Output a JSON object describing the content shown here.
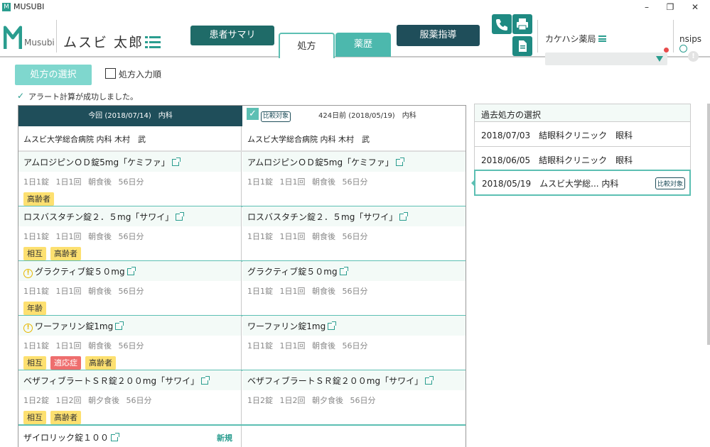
{
  "window": {
    "title": "MUSUBI",
    "app_icon": "M"
  },
  "header": {
    "brand": "Musubi",
    "patient_name": "ムスビ 太郎",
    "buttons": {
      "summary": "患者サマリ",
      "guidance": "服薬指導"
    },
    "tabs": {
      "prescription": "処方",
      "history": "薬歴"
    },
    "pharmacy": "カケハシ薬局",
    "nsips": "nsips"
  },
  "toolbar": {
    "select_prescription": "処方の選択",
    "input_order_label": "処方入力順",
    "alert_message": "アラート計算が成功しました。"
  },
  "grid": {
    "current_header": "今回 (2018/07/14)　内科",
    "compare_badge": "比較対象",
    "compare_header": "424日前 (2018/05/19)　内科",
    "hospital_left": "ムスビ大学総合病院 内科 木村　武",
    "hospital_right": "ムスビ大学総合病院 内科 木村　武",
    "rows": [
      {
        "left": {
          "name": "アムロジピンＯＤ錠5mg「ケミファ」",
          "dose": "1日1錠 1日1回 朝食後 56日分",
          "tags": [
            "高齢者"
          ]
        },
        "right": {
          "name": "アムロジピンＯＤ錠5mg「ケミファ」",
          "dose": "1日1錠 1日1回 朝食後 56日分"
        }
      },
      {
        "left": {
          "name": "ロスバスタチン錠２．５mg「サワイ」",
          "dose": "1日1錠 1日1回 朝食後 56日分",
          "tags": [
            "相互",
            "高齢者"
          ]
        },
        "right": {
          "name": "ロスバスタチン錠２．５mg「サワイ」",
          "dose": "1日1錠 1日1回 朝食後 56日分"
        }
      },
      {
        "left": {
          "name": "グラクティブ錠５０mg",
          "dose": "1日1錠 1日1回 朝食後 56日分",
          "tags": [
            "年齢"
          ]
        },
        "right": {
          "name": "グラクティブ錠５０mg",
          "dose": "1日1錠 1日1回 朝食後 56日分"
        }
      },
      {
        "left": {
          "name": "ワーファリン錠1mg",
          "dose": "1日1錠 1日1回 朝食後 56日分",
          "tags": [
            "相互",
            "適応症",
            "高齢者"
          ]
        },
        "right": {
          "name": "ワーファリン錠1mg",
          "dose": "1日1錠 1日1回 朝食後 56日分"
        }
      },
      {
        "left": {
          "name": "ベザフィブラートＳＲ錠２００mg「サワイ」",
          "dose": "1日2錠 1日2回 朝夕食後 56日分",
          "tags": [
            "相互",
            "高齢者"
          ]
        },
        "right": {
          "name": "ベザフィブラートＳＲ錠２００mg「サワイ」",
          "dose": "1日2錠 1日2回 朝夕食後 56日分"
        }
      }
    ],
    "last_row": {
      "name": "ザイロリック錠１００",
      "new_label": "新規"
    }
  },
  "history_panel": {
    "title": "過去処方の選択",
    "items": [
      {
        "label": "2018/07/03　結眼科クリニック　眼科"
      },
      {
        "label": "2018/06/05　結眼科クリニック　眼科"
      },
      {
        "label": "2018/05/19　ムスビ大学総...  内科",
        "badge": "比較対象"
      }
    ]
  },
  "colors": {
    "dark_teal": "#1f6b68",
    "navy": "#1f4e5a",
    "accent": "#2a9d8f",
    "tag_yellow": "#fde070",
    "tag_red": "#ee6e6e"
  }
}
